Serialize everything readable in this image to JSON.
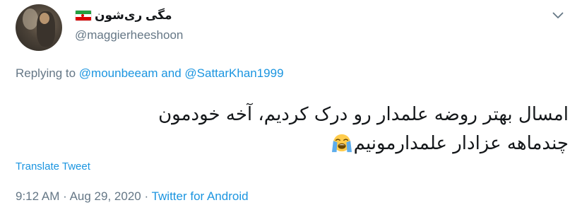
{
  "user": {
    "display_name": "مگی ری‌شون",
    "handle": "@maggierheeshoon",
    "flag": "iran-flag"
  },
  "replying": {
    "prefix": "Replying to",
    "mention_1": "@mounbeeam",
    "conjunction": "and",
    "mention_2": "@SattarKhan1999"
  },
  "tweet": {
    "line_1": "امسال بهتر روضه علمدار رو درک کردیم، آخه خودمون",
    "line_2": "چندماهه عزادار علمدارمونیم",
    "emoji": "loudly-crying-face-emoji"
  },
  "translate_label": "Translate Tweet",
  "meta": {
    "time": "9:12 AM",
    "separator": "·",
    "date": "Aug 29, 2020",
    "source": "Twitter for Android"
  },
  "colors": {
    "link": "#1b95e0",
    "secondary_text": "#657786",
    "primary_text": "#14171a"
  },
  "icons": {
    "menu": "chevron-down-icon"
  }
}
